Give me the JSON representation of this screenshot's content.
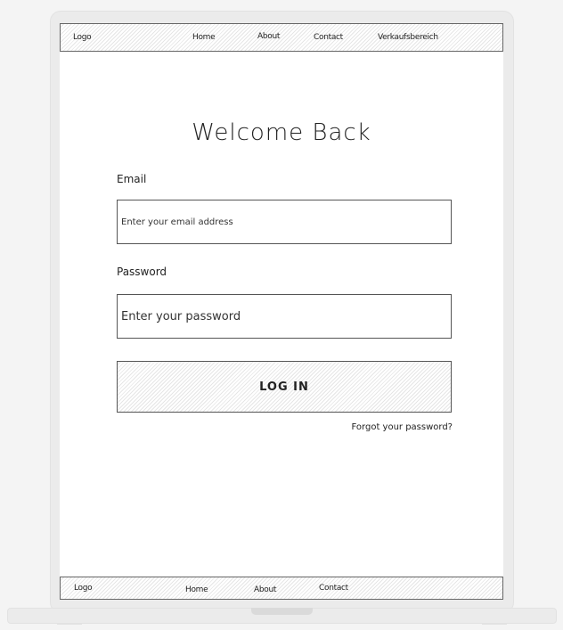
{
  "header": {
    "logo": "Logo",
    "nav": [
      "Home",
      "About",
      "Contact",
      "Verkaufsbereich"
    ]
  },
  "main": {
    "title": "Welcome Back",
    "email_label": "Email",
    "email_placeholder": "Enter your email address",
    "password_label": "Password",
    "password_placeholder": "Enter your password",
    "login_label": "LOG IN",
    "forgot_label": "Forgot your password?"
  },
  "footer": {
    "logo": "Logo",
    "nav": [
      "Home",
      "About",
      "Contact"
    ]
  }
}
